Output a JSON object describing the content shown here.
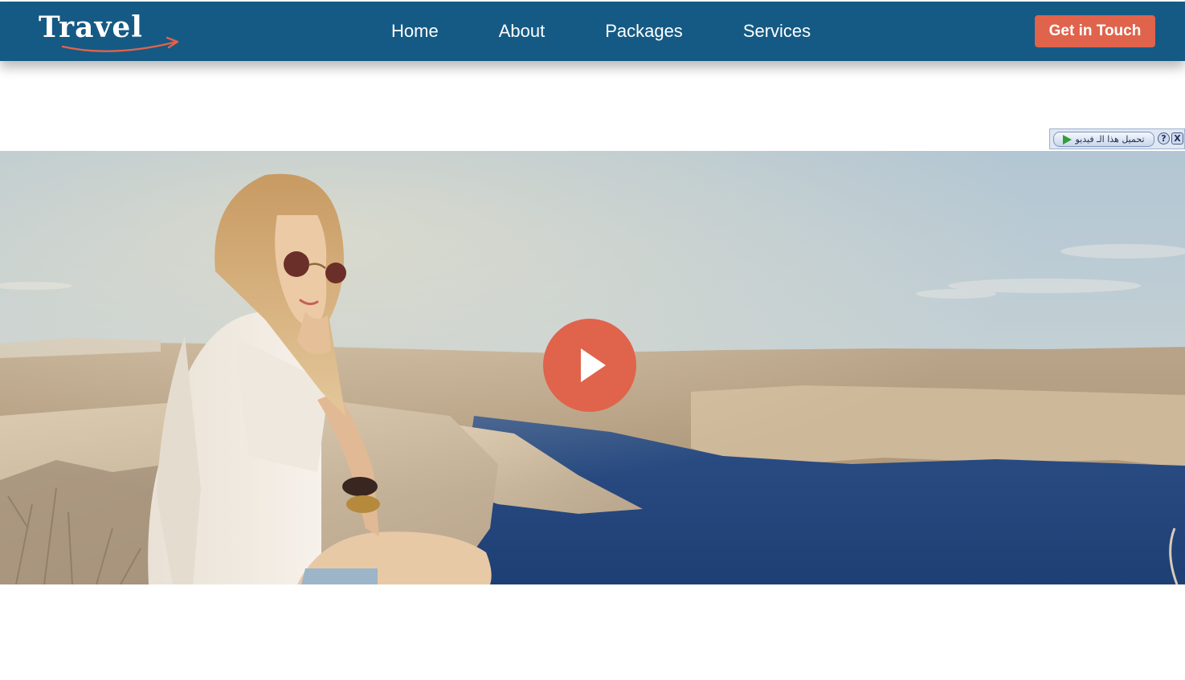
{
  "colors": {
    "nav_bg": "#155a84",
    "accent": "#e0634c",
    "logo_swoosh": "#e0634c"
  },
  "header": {
    "logo_text": "Travel",
    "nav_items": [
      {
        "label": "Home"
      },
      {
        "label": "About"
      },
      {
        "label": "Packages"
      },
      {
        "label": "Services"
      }
    ],
    "cta_label": "Get in Touch"
  },
  "download_toolbar": {
    "button_label": "تحميل هذا الـ فيديو",
    "play_icon": "play-icon",
    "help_label": "?",
    "close_label": "X"
  },
  "hero": {
    "image_subject": "woman-in-sunglasses-on-seaside-cliff",
    "play_icon": "play-icon"
  }
}
